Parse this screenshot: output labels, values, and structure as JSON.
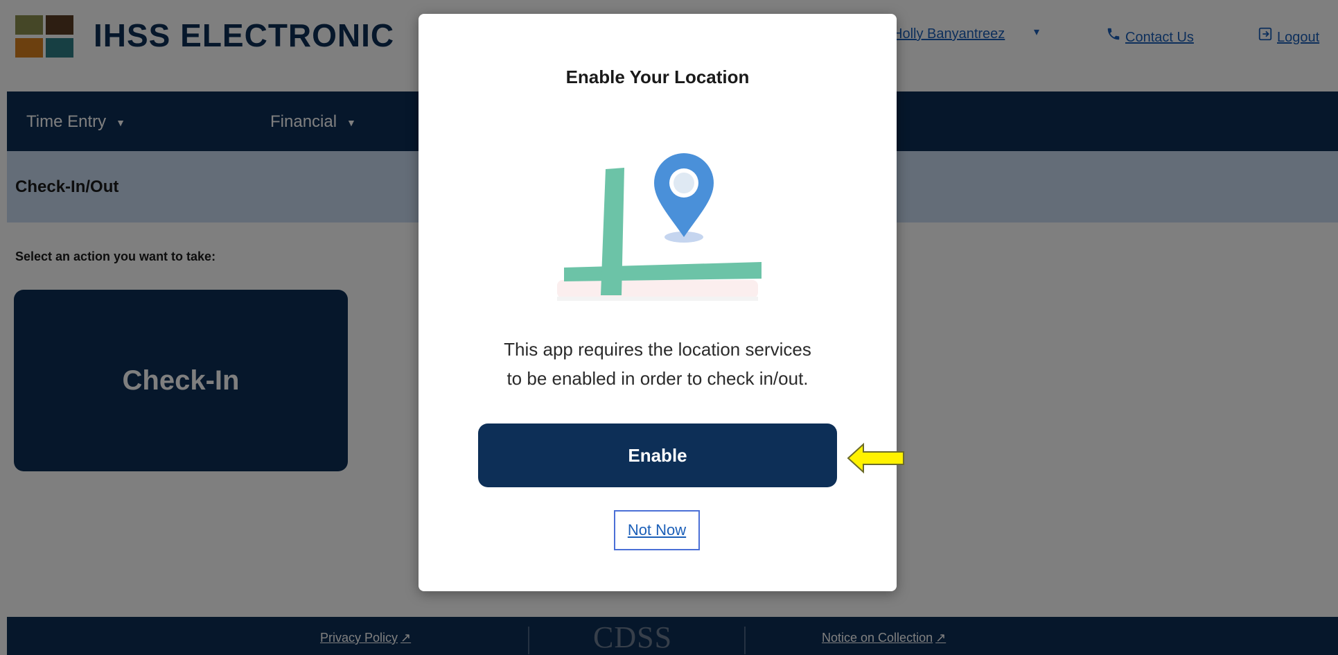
{
  "app": {
    "title": "IHSS ELECTRONIC",
    "logo_colors": [
      "#8a8f4f",
      "#5a3d25",
      "#d9801f",
      "#2e7f86"
    ]
  },
  "header": {
    "user_name": "Holly Banyantreez",
    "user_caret": "▾",
    "contact_label": "Contact Us",
    "logout_label": "Logout"
  },
  "nav": {
    "items": [
      {
        "label": "Time Entry"
      },
      {
        "label": "Financial"
      }
    ]
  },
  "subheader": {
    "title": "Check-In/Out"
  },
  "main": {
    "prompt": "Select an action you want to take:",
    "checkin_label": "Check-In"
  },
  "footer": {
    "privacy_label": "Privacy Policy",
    "cdss_logo": "CDSS",
    "notice_label": "Notice on Collection"
  },
  "modal": {
    "title": "Enable Your Location",
    "message_line1": "This app requires the location services",
    "message_line2": "to be enabled in order to check in/out.",
    "enable_label": "Enable",
    "not_now_label": "Not Now",
    "icon": "map-location-pin-icon"
  },
  "colors": {
    "navy": "#0d2f57",
    "light_blue_bar": "#c8daf0",
    "link_blue": "#1b5fb8",
    "pin_blue": "#4a90d9",
    "road_green": "#6cc3a7",
    "arrow_yellow": "#fff200"
  }
}
